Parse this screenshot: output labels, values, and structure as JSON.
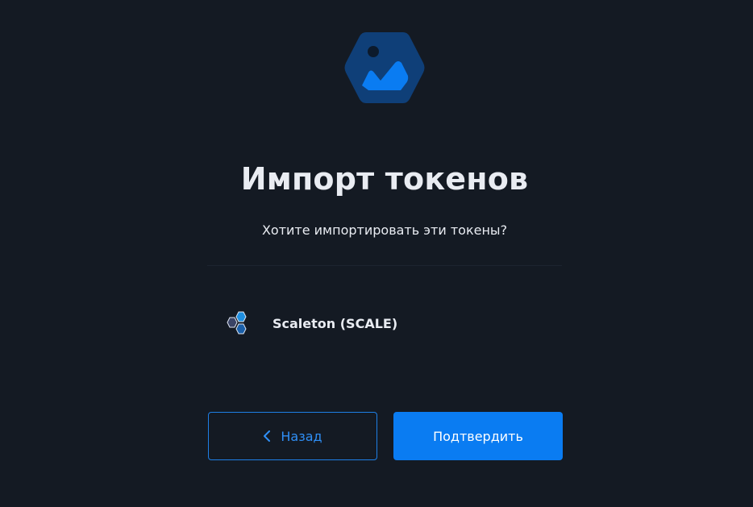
{
  "dialog": {
    "title": "Импорт токенов",
    "subtitle": "Хотите импортировать эти токены?"
  },
  "token": {
    "name": "Scaleton (SCALE)",
    "icon": "scaleton-hexagons-icon"
  },
  "buttons": {
    "back_label": "Назад",
    "confirm_label": "Подтвердить"
  },
  "icons": {
    "header": "image-hexagon-icon",
    "back": "chevron-left-icon"
  },
  "colors": {
    "background": "#141a23",
    "accent": "#0a7cf2",
    "logo_bg": "#0f3f78"
  }
}
